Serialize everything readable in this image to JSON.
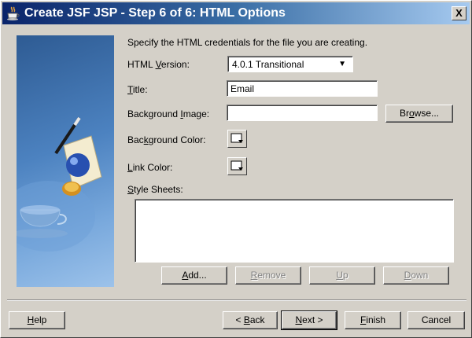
{
  "window": {
    "title": "Create JSF JSP - Step 6 of 6: HTML Options",
    "close_label": "X"
  },
  "form": {
    "intro": "Specify the HTML credentials for the file you are creating.",
    "html_version": {
      "label_pre": "HTML ",
      "label_mn": "V",
      "label_post": "ersion:",
      "value": "4.0.1 Transitional"
    },
    "title_field": {
      "label_pre": "",
      "label_mn": "T",
      "label_post": "itle:",
      "value": "Email"
    },
    "background_image": {
      "label_pre": "Background ",
      "label_mn": "I",
      "label_post": "mage:",
      "value": ""
    },
    "browse_button": {
      "pre": "Br",
      "mn": "o",
      "post": "wse..."
    },
    "background_color": {
      "label_pre": "Bac",
      "label_mn": "k",
      "label_post": "ground Color:"
    },
    "link_color": {
      "label_pre": "",
      "label_mn": "L",
      "label_post": "ink Color:"
    },
    "style_sheets": {
      "label_pre": "",
      "label_mn": "S",
      "label_post": "tyle Sheets:"
    }
  },
  "list_buttons": {
    "add": {
      "pre": "",
      "mn": "A",
      "post": "dd..."
    },
    "remove": {
      "pre": "",
      "mn": "R",
      "post": "emove"
    },
    "up": {
      "pre": "",
      "mn": "U",
      "post": "p"
    },
    "down": {
      "pre": "",
      "mn": "D",
      "post": "own"
    }
  },
  "footer": {
    "help": {
      "pre": "",
      "mn": "H",
      "post": "elp"
    },
    "back": {
      "pre": "< ",
      "mn": "B",
      "post": "ack"
    },
    "next": {
      "pre": "",
      "mn": "N",
      "post": "ext >"
    },
    "finish": {
      "pre": "",
      "mn": "F",
      "post": "inish"
    },
    "cancel": "Cancel"
  },
  "icons": {
    "title_icon": "java-cup-icon",
    "color_picker": "color-picker-icon",
    "dropdown": "chevron-down-icon"
  }
}
